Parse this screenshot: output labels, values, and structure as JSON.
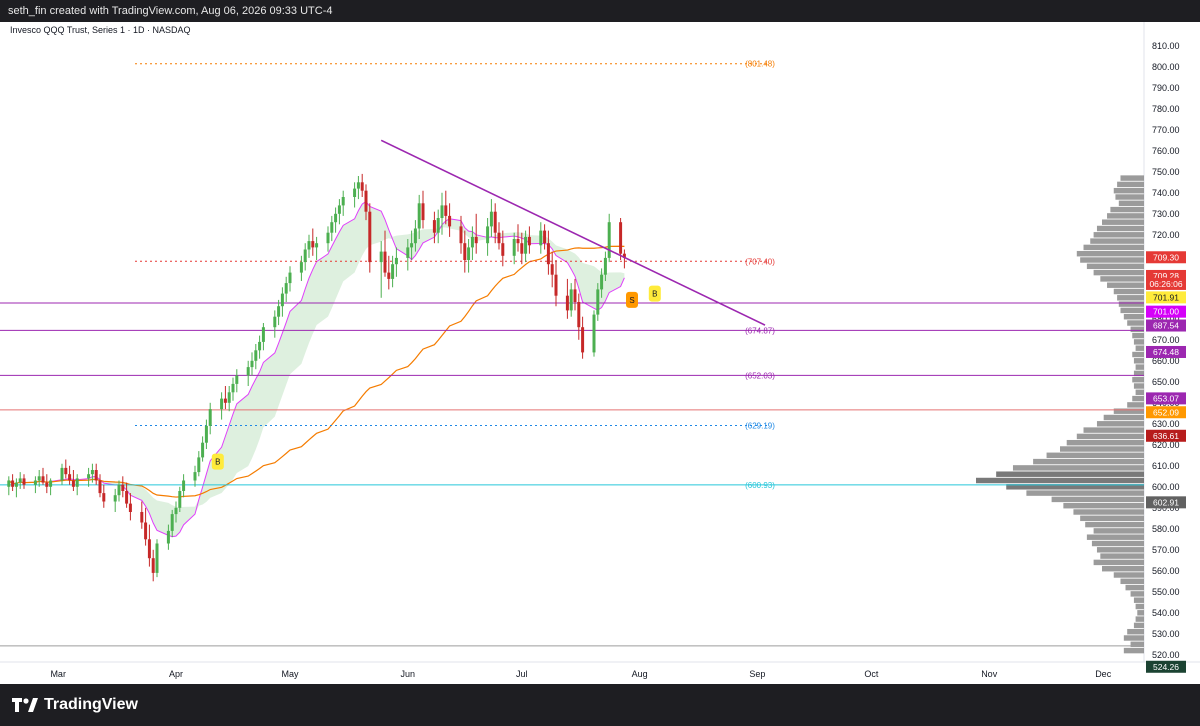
{
  "header": {
    "credit": "seth_fin created with TradingView.com, Aug 06, 2026 09:33 UTC-4"
  },
  "footer": {
    "brand": "TradingView"
  },
  "chart_data": {
    "type": "candlestick",
    "title": "Invesco QQQ Trust, Series 1 · 1D · NASDAQ",
    "ylim": [
      518,
      818
    ],
    "y_ticks": [
      520,
      530,
      540,
      550,
      560,
      570,
      580,
      590,
      600,
      610,
      620,
      630,
      640,
      650,
      660,
      670,
      680,
      690,
      700,
      710,
      720,
      730,
      740,
      750,
      760,
      770,
      780,
      790,
      800,
      810
    ],
    "x_months": [
      {
        "label": "Mar",
        "date": "2026-03-01"
      },
      {
        "label": "Apr",
        "date": "2026-04-01"
      },
      {
        "label": "May",
        "date": "2026-05-01"
      },
      {
        "label": "Jun",
        "date": "2026-06-01"
      },
      {
        "label": "Jul",
        "date": "2026-07-01"
      },
      {
        "label": "Aug",
        "date": "2026-08-01"
      },
      {
        "label": "Sep",
        "date": "2026-09-01"
      },
      {
        "label": "Oct",
        "date": "2026-10-01"
      },
      {
        "label": "Nov",
        "date": "2026-11-01"
      },
      {
        "label": "Dec",
        "date": "2026-12-01"
      }
    ],
    "candles_ohlc": [
      [
        600,
        605,
        596,
        603
      ],
      [
        603,
        606,
        598,
        600
      ],
      [
        600,
        604,
        595,
        602
      ],
      [
        602,
        607,
        599,
        604
      ],
      [
        604,
        606,
        599,
        601
      ],
      [
        601,
        605,
        597,
        603
      ],
      [
        603,
        608,
        600,
        605
      ],
      [
        605,
        609,
        601,
        602
      ],
      [
        602,
        606,
        597,
        600
      ],
      [
        600,
        604,
        596,
        603
      ],
      [
        603,
        611,
        601,
        609
      ],
      [
        609,
        613,
        604,
        606
      ],
      [
        606,
        610,
        601,
        603
      ],
      [
        603,
        608,
        598,
        600
      ],
      [
        600,
        606,
        596,
        604
      ],
      [
        604,
        609,
        600,
        606
      ],
      [
        606,
        611,
        602,
        608
      ],
      [
        608,
        611,
        601,
        603
      ],
      [
        603,
        606,
        595,
        597
      ],
      [
        597,
        601,
        590,
        593
      ],
      [
        593,
        599,
        588,
        596
      ],
      [
        596,
        603,
        593,
        601
      ],
      [
        601,
        605,
        595,
        598
      ],
      [
        598,
        602,
        590,
        592
      ],
      [
        592,
        597,
        584,
        588
      ],
      [
        588,
        593,
        580,
        583
      ],
      [
        583,
        590,
        572,
        575
      ],
      [
        575,
        582,
        562,
        566
      ],
      [
        566,
        570,
        555,
        559
      ],
      [
        559,
        575,
        557,
        573
      ],
      [
        573,
        582,
        570,
        579
      ],
      [
        579,
        589,
        576,
        587
      ],
      [
        587,
        593,
        583,
        590
      ],
      [
        590,
        600,
        588,
        598
      ],
      [
        598,
        606,
        595,
        603
      ],
      [
        603,
        610,
        600,
        607
      ],
      [
        607,
        617,
        605,
        614
      ],
      [
        614,
        624,
        612,
        621
      ],
      [
        621,
        632,
        618,
        629
      ],
      [
        629,
        640,
        625,
        637
      ],
      [
        637,
        645,
        632,
        642
      ],
      [
        642,
        648,
        637,
        640
      ],
      [
        640,
        648,
        636,
        645
      ],
      [
        645,
        652,
        641,
        649
      ],
      [
        649,
        656,
        645,
        653
      ],
      [
        653,
        660,
        648,
        657
      ],
      [
        657,
        664,
        653,
        660
      ],
      [
        660,
        668,
        656,
        665
      ],
      [
        665,
        672,
        661,
        669
      ],
      [
        669,
        678,
        665,
        676
      ],
      [
        676,
        684,
        671,
        681
      ],
      [
        681,
        689,
        677,
        686
      ],
      [
        686,
        695,
        681,
        692
      ],
      [
        692,
        700,
        688,
        697
      ],
      [
        697,
        705,
        693,
        702
      ],
      [
        702,
        710,
        698,
        707
      ],
      [
        707,
        716,
        703,
        713
      ],
      [
        713,
        720,
        709,
        717
      ],
      [
        717,
        723,
        710,
        714
      ],
      [
        714,
        719,
        708,
        716
      ],
      [
        716,
        724,
        712,
        721
      ],
      [
        721,
        729,
        717,
        726
      ],
      [
        726,
        733,
        721,
        730
      ],
      [
        730,
        737,
        725,
        734
      ],
      [
        734,
        741,
        729,
        738
      ],
      [
        738,
        745,
        733,
        742
      ],
      [
        742,
        748,
        737,
        745
      ],
      [
        745,
        749,
        738,
        741
      ],
      [
        741,
        744,
        727,
        731
      ],
      [
        731,
        735,
        702,
        707
      ],
      [
        707,
        717,
        690,
        712
      ],
      [
        712,
        722,
        700,
        702
      ],
      [
        702,
        710,
        694,
        699
      ],
      [
        699,
        710,
        695,
        706
      ],
      [
        706,
        714,
        700,
        709
      ],
      [
        709,
        718,
        703,
        714
      ],
      [
        714,
        722,
        708,
        716
      ],
      [
        716,
        727,
        712,
        723
      ],
      [
        723,
        739,
        718,
        735
      ],
      [
        735,
        741,
        723,
        727
      ],
      [
        727,
        731,
        716,
        721
      ],
      [
        721,
        732,
        716,
        728
      ],
      [
        728,
        740,
        720,
        734
      ],
      [
        734,
        741,
        725,
        729
      ],
      [
        729,
        735,
        719,
        724
      ],
      [
        724,
        729,
        711,
        716
      ],
      [
        716,
        722,
        702,
        708
      ],
      [
        708,
        718,
        702,
        714
      ],
      [
        714,
        724,
        708,
        719
      ],
      [
        719,
        730,
        711,
        716
      ],
      [
        716,
        728,
        710,
        724
      ],
      [
        724,
        737,
        719,
        731
      ],
      [
        731,
        735,
        716,
        721
      ],
      [
        721,
        726,
        713,
        716
      ],
      [
        716,
        722,
        705,
        710
      ],
      [
        710,
        721,
        706,
        718
      ],
      [
        718,
        725,
        712,
        716
      ],
      [
        716,
        721,
        706,
        711
      ],
      [
        711,
        722,
        707,
        719
      ],
      [
        719,
        724,
        711,
        715
      ],
      [
        715,
        726,
        711,
        722
      ],
      [
        722,
        725,
        713,
        716
      ],
      [
        716,
        722,
        701,
        706
      ],
      [
        706,
        712,
        695,
        701
      ],
      [
        701,
        708,
        686,
        691
      ],
      [
        691,
        699,
        680,
        684
      ],
      [
        684,
        697,
        681,
        694
      ],
      [
        694,
        699,
        684,
        688
      ],
      [
        688,
        692,
        670,
        676
      ],
      [
        676,
        681,
        661,
        664
      ],
      [
        664,
        684,
        662,
        682
      ],
      [
        682,
        697,
        679,
        694
      ],
      [
        694,
        704,
        690,
        701
      ],
      [
        701,
        712,
        698,
        709
      ],
      [
        709,
        730,
        707,
        726
      ],
      [
        726,
        728,
        708,
        711
      ],
      [
        711,
        713,
        704,
        709
      ]
    ],
    "current_price": 709.3,
    "price_labels": [
      {
        "text": "709.30",
        "value": 709.3,
        "color": "#e53935"
      },
      {
        "text": "709.28",
        "value": 700.4,
        "color": "#e53935"
      },
      {
        "text": "06:26:06",
        "value": 696.6,
        "color": "#e53935"
      },
      {
        "text": "701.91",
        "value": 690.2,
        "color": "#ffeb3b"
      },
      {
        "text": "701.00",
        "value": 683.4,
        "color": "#d500f9"
      },
      {
        "text": "687.54",
        "value": 676.8,
        "color": "#9c27b0"
      },
      {
        "text": "674.48",
        "value": 664.2,
        "color": "#9c27b0"
      },
      {
        "text": "653.07",
        "value": 642.1,
        "color": "#9c27b0"
      },
      {
        "text": "652.09",
        "value": 635.5,
        "color": "#ff9800"
      },
      {
        "text": "636.61",
        "value": 624.3,
        "color": "#b71c1c"
      },
      {
        "text": "602.91",
        "value": 592.6,
        "color": "#616161"
      },
      {
        "text": "524.26",
        "value": 514.3,
        "color": "#1b4332"
      }
    ],
    "horizontal_levels": [
      {
        "value": 801.48,
        "label": "(801.48)",
        "color": "#f57c00",
        "style": "dotted"
      },
      {
        "value": 707.4,
        "label": "(707.40)",
        "color": "#e53935",
        "style": "dotted"
      },
      {
        "value": 687.54,
        "label": "",
        "color": "#9c27b0",
        "style": "solid"
      },
      {
        "value": 674.48,
        "label": "(674.87)",
        "color": "#9c27b0",
        "style": "solid"
      },
      {
        "value": 653.07,
        "label": "(652.03)",
        "color": "#9c27b0",
        "style": "solid"
      },
      {
        "value": 636.61,
        "label": "",
        "color": "#e57373",
        "style": "solid"
      },
      {
        "value": 629.19,
        "label": "(629.19)",
        "color": "#1e88e5",
        "style": "dotted"
      },
      {
        "value": 600.93,
        "label": "(600.93)",
        "color": "#26c6da",
        "style": "solid"
      },
      {
        "value": 524.26,
        "label": "",
        "color": "#9e9e9e",
        "style": "solid"
      }
    ],
    "trendline": [
      {
        "date": "2026-05-25",
        "value": 765
      },
      {
        "date": "2026-09-03",
        "value": 677
      }
    ],
    "signals": [
      {
        "text": "B",
        "date": "2026-04-12",
        "value": 612,
        "color": "#ffeb3b"
      },
      {
        "text": "S",
        "date": "2026-07-30",
        "value": 689,
        "color": "#ff9800"
      },
      {
        "text": "B",
        "date": "2026-08-05",
        "value": 692,
        "color": "#ffeb3b"
      }
    ],
    "volume_profile": [
      {
        "price": 747,
        "volume": 0.14
      },
      {
        "price": 744,
        "volume": 0.16
      },
      {
        "price": 741,
        "volume": 0.18
      },
      {
        "price": 738,
        "volume": 0.17
      },
      {
        "price": 735,
        "volume": 0.15
      },
      {
        "price": 732,
        "volume": 0.2
      },
      {
        "price": 729,
        "volume": 0.22
      },
      {
        "price": 726,
        "volume": 0.25
      },
      {
        "price": 723,
        "volume": 0.28
      },
      {
        "price": 720,
        "volume": 0.3
      },
      {
        "price": 717,
        "volume": 0.32
      },
      {
        "price": 714,
        "volume": 0.36
      },
      {
        "price": 711,
        "volume": 0.4
      },
      {
        "price": 708,
        "volume": 0.38
      },
      {
        "price": 705,
        "volume": 0.34
      },
      {
        "price": 702,
        "volume": 0.3
      },
      {
        "price": 699,
        "volume": 0.26
      },
      {
        "price": 696,
        "volume": 0.22
      },
      {
        "price": 693,
        "volume": 0.18
      },
      {
        "price": 690,
        "volume": 0.16
      },
      {
        "price": 687,
        "volume": 0.15
      },
      {
        "price": 684,
        "volume": 0.14
      },
      {
        "price": 681,
        "volume": 0.12
      },
      {
        "price": 678,
        "volume": 0.1
      },
      {
        "price": 675,
        "volume": 0.08
      },
      {
        "price": 672,
        "volume": 0.07
      },
      {
        "price": 669,
        "volume": 0.06
      },
      {
        "price": 666,
        "volume": 0.05
      },
      {
        "price": 663,
        "volume": 0.07
      },
      {
        "price": 660,
        "volume": 0.06
      },
      {
        "price": 657,
        "volume": 0.05
      },
      {
        "price": 654,
        "volume": 0.06
      },
      {
        "price": 651,
        "volume": 0.07
      },
      {
        "price": 648,
        "volume": 0.06
      },
      {
        "price": 645,
        "volume": 0.05
      },
      {
        "price": 642,
        "volume": 0.07
      },
      {
        "price": 639,
        "volume": 0.1
      },
      {
        "price": 636,
        "volume": 0.18
      },
      {
        "price": 633,
        "volume": 0.24
      },
      {
        "price": 630,
        "volume": 0.28
      },
      {
        "price": 627,
        "volume": 0.36
      },
      {
        "price": 624,
        "volume": 0.4
      },
      {
        "price": 621,
        "volume": 0.46
      },
      {
        "price": 618,
        "volume": 0.5
      },
      {
        "price": 615,
        "volume": 0.58
      },
      {
        "price": 612,
        "volume": 0.66
      },
      {
        "price": 609,
        "volume": 0.78
      },
      {
        "price": 606,
        "volume": 0.88
      },
      {
        "price": 603,
        "volume": 1.0
      },
      {
        "price": 600,
        "volume": 0.82
      },
      {
        "price": 597,
        "volume": 0.7
      },
      {
        "price": 594,
        "volume": 0.55
      },
      {
        "price": 591,
        "volume": 0.48
      },
      {
        "price": 588,
        "volume": 0.42
      },
      {
        "price": 585,
        "volume": 0.38
      },
      {
        "price": 582,
        "volume": 0.35
      },
      {
        "price": 579,
        "volume": 0.3
      },
      {
        "price": 576,
        "volume": 0.34
      },
      {
        "price": 573,
        "volume": 0.31
      },
      {
        "price": 570,
        "volume": 0.28
      },
      {
        "price": 567,
        "volume": 0.26
      },
      {
        "price": 564,
        "volume": 0.3
      },
      {
        "price": 561,
        "volume": 0.25
      },
      {
        "price": 558,
        "volume": 0.18
      },
      {
        "price": 555,
        "volume": 0.14
      },
      {
        "price": 552,
        "volume": 0.11
      },
      {
        "price": 549,
        "volume": 0.08
      },
      {
        "price": 546,
        "volume": 0.06
      },
      {
        "price": 543,
        "volume": 0.05
      },
      {
        "price": 540,
        "volume": 0.04
      },
      {
        "price": 537,
        "volume": 0.05
      },
      {
        "price": 534,
        "volume": 0.06
      },
      {
        "price": 531,
        "volume": 0.1
      },
      {
        "price": 528,
        "volume": 0.12
      },
      {
        "price": 525,
        "volume": 0.08
      },
      {
        "price": 522,
        "volume": 0.12
      }
    ],
    "colors": {
      "up": "#4caf50",
      "down": "#c62828",
      "ma": "#f57c00",
      "ma_fast": "#e040fb",
      "cloud": "#c8e6c9"
    }
  }
}
